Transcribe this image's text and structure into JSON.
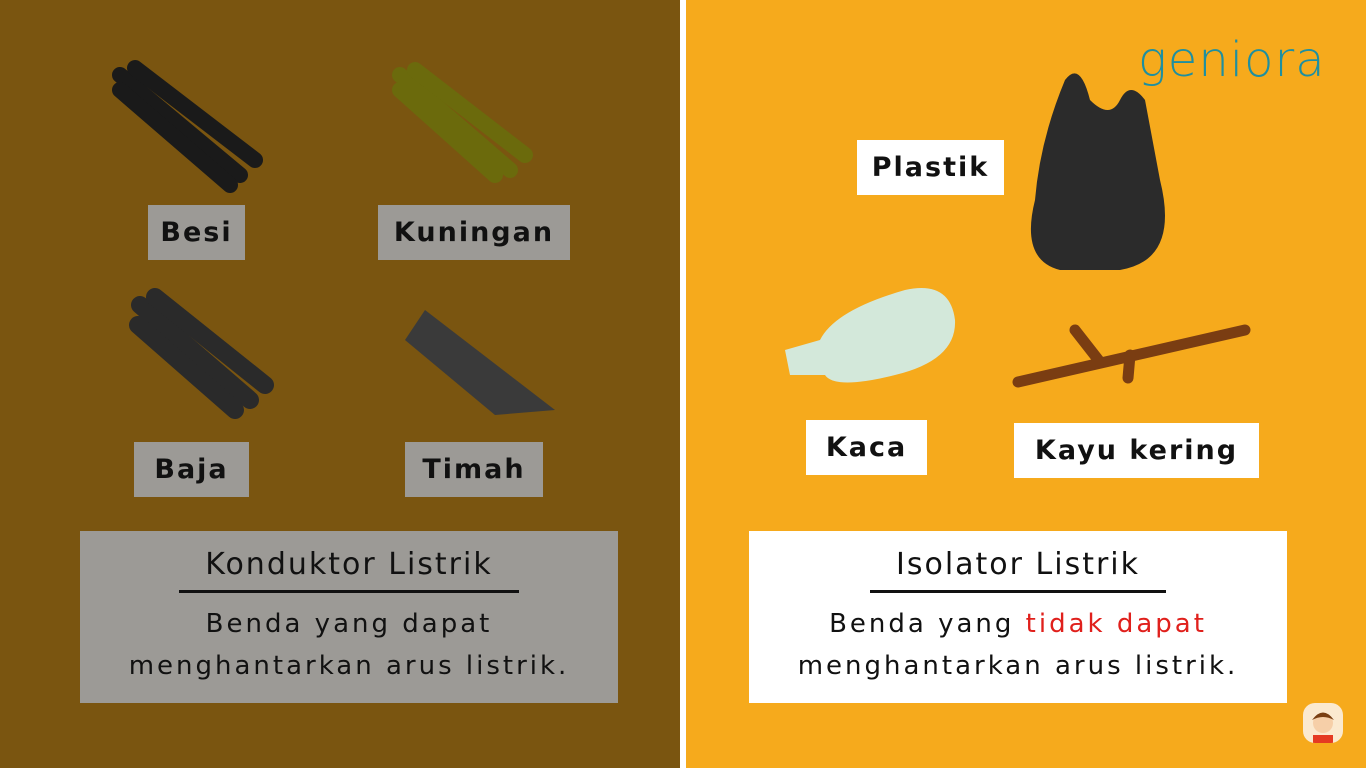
{
  "conductor": {
    "items": [
      "Besi",
      "Kuningan",
      "Baja",
      "Timah"
    ],
    "title": "Konduktor Listrik",
    "desc_line1": "Benda yang dapat",
    "desc_line2": "menghantarkan arus listrik."
  },
  "insulator": {
    "items": [
      "Plastik",
      "Kaca",
      "Kayu kering"
    ],
    "title": "Isolator Listrik",
    "desc_pre": "Benda yang ",
    "desc_highlight": "tidak dapat",
    "desc_line2": "menghantarkan arus listrik."
  },
  "logo": "geniora",
  "colors": {
    "left_bg": "#7a5510",
    "right_bg": "#f6aa1c",
    "highlight": "#e0201c",
    "logo": "#1e8fa0"
  }
}
